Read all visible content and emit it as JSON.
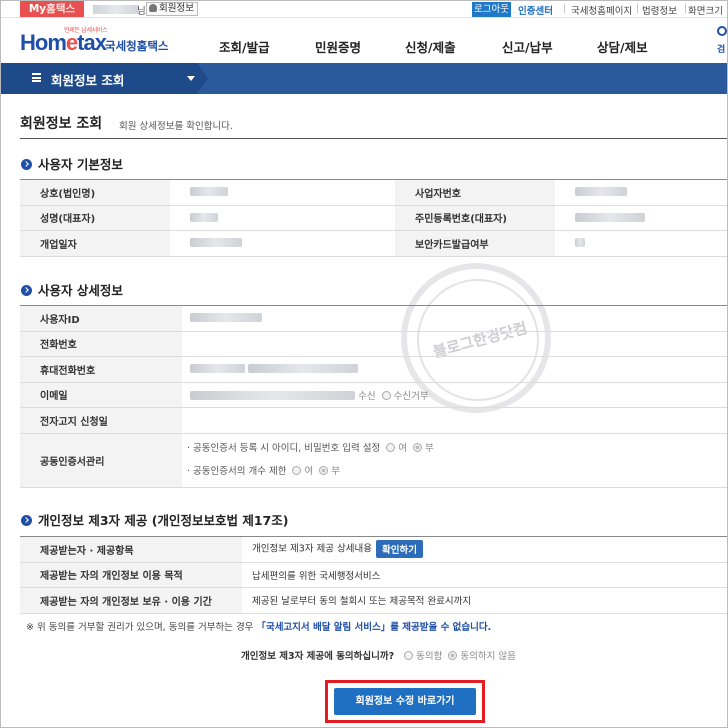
{
  "topbar": {
    "myhometax_prefix": "My",
    "myhometax_suffix": "홈택스",
    "username_suffix": "님",
    "member_info": "회원정보",
    "logout": "로그아웃",
    "cert_center": "인증센터",
    "links": [
      "국세청홈페이지",
      "법령정보",
      "화면크기"
    ]
  },
  "header": {
    "logo_tag": "언제든 납세서비스",
    "logo_word_a": "Hom",
    "logo_word_e": "e",
    "logo_word_b": "tax",
    "logo_kr": "국세청홈택스",
    "nav": [
      "조회/발급",
      "민원증명",
      "신청/제출",
      "신고/납부",
      "상담/제보"
    ],
    "search_label": "검"
  },
  "menubar": {
    "title": "회원정보 조회"
  },
  "page": {
    "title": "회원정보 조회",
    "desc": "회원 상세정보를 확인합니다."
  },
  "basic": {
    "heading": "사용자 기본정보",
    "rows": [
      {
        "l1": "상호(법인명)",
        "l2": "사업자번호"
      },
      {
        "l1": "성명(대표자)",
        "l2": "주민등록번호(대표자)"
      },
      {
        "l1": "개업일자",
        "l2": "보안카드발급여부"
      }
    ]
  },
  "detail": {
    "heading": "사용자 상세정보",
    "rows": [
      "사용자ID",
      "전화번호",
      "휴대전화번호",
      "이메일",
      "전자고지 신청일",
      "공동인증서관리"
    ],
    "email_receive": "수신",
    "email_reject": "수신거부",
    "cert_line1": "· 공동인증서 등록 시 아이디, 비밀번호 입력 설정",
    "cert_line2": "· 공동인증서의 개수 제한",
    "yes": "여",
    "no": "부"
  },
  "privacy": {
    "heading": "개인정보 제3자 제공 (개인정보보호법 제17조)",
    "rows": [
      {
        "label": "제공받는자 · 제공항목",
        "value": "개인정보 제3자 제공 상세내용",
        "button": "확인하기"
      },
      {
        "label": "제공받는 자의 개인정보 이용 목적",
        "value": "납세편의를 위한 국세행정서비스"
      },
      {
        "label": "제공받는 자의 개인정보 보유 · 이용 기간",
        "value": "제공된 날로부터 동의 철회시 또는 제공목적 완료시까지"
      }
    ],
    "note_a": "※ 위 동의를 거부할 권리가 있으며, 동의를 거부하는 경우",
    "note_link": "「국세고지서 배달 알림 서비스」를 제공받을 수 없습니다.",
    "agree_question": "개인정보 제3자 제공에 동의하십니까?",
    "agree": "동의함",
    "disagree": "동의하지 않음"
  },
  "watermark": {
    "text": "블로그한경닷컴"
  },
  "main_button": "회원정보 수정 바로가기"
}
